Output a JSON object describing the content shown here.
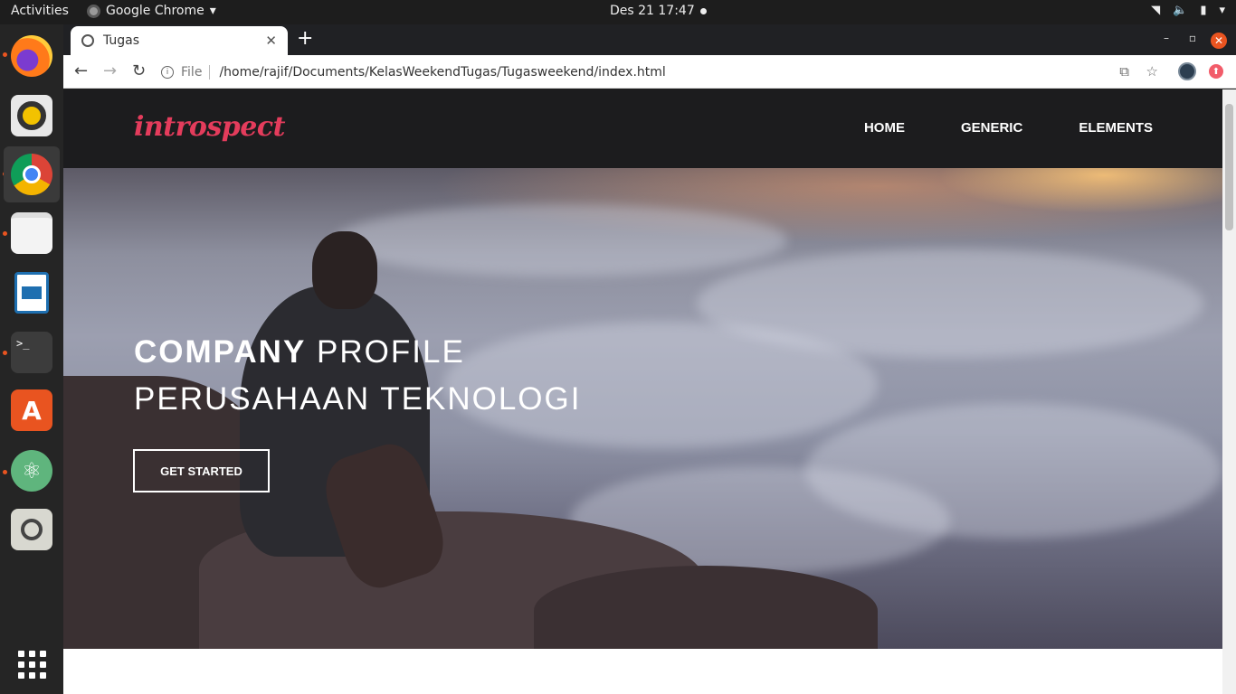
{
  "system": {
    "activities": "Activities",
    "app_name": "Google Chrome",
    "clock": "Des 21  17:47"
  },
  "dock": {
    "items": [
      "firefox-icon",
      "rhythmbox-icon",
      "chrome-icon",
      "files-icon",
      "writer-icon",
      "terminal-icon",
      "software-icon",
      "atom-icon",
      "screenshot-icon",
      "app-grid-icon"
    ]
  },
  "browser": {
    "tab_title": "Tugas",
    "file_label": "File",
    "url": "/home/rajif/Documents/KelasWeekendTugas/Tugasweekend/index.html"
  },
  "site": {
    "logo": "introspect",
    "nav": [
      "HOME",
      "GENERIC",
      "ELEMENTS"
    ],
    "hero": {
      "title_bold": "COMPANY",
      "title_light": " PROFILE",
      "subtitle": "PERUSAHAAN TEKNOLOGI",
      "button": "GET STARTED"
    }
  },
  "colors": {
    "accent_logo": "#e43c5c",
    "header_bg": "#1c1c1e",
    "ubuntu_orange": "#e95420"
  }
}
